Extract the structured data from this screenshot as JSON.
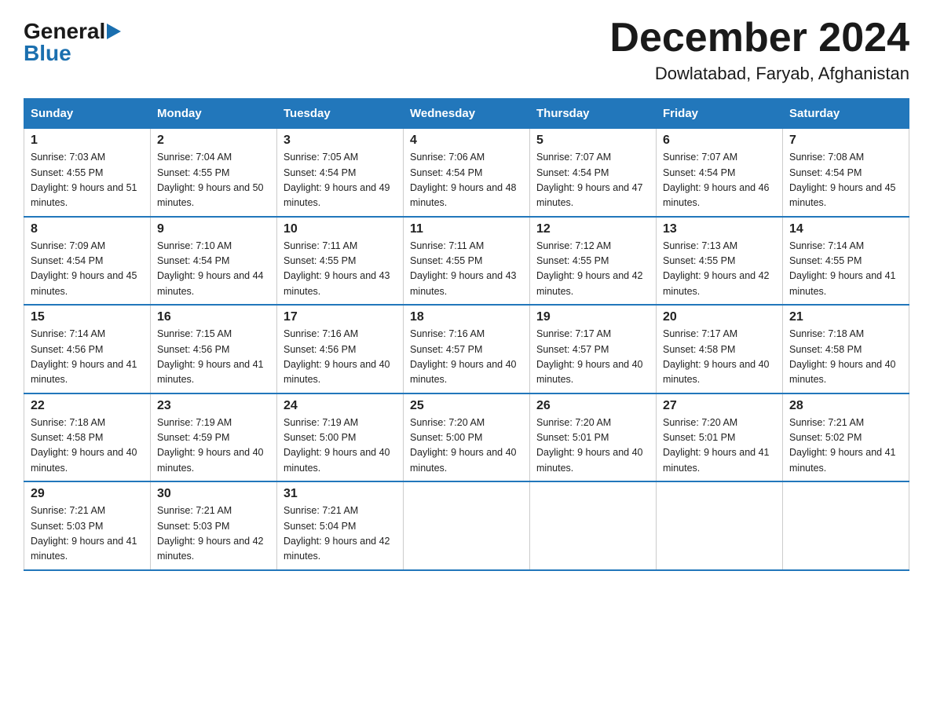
{
  "header": {
    "logo_general": "General",
    "logo_blue": "Blue",
    "month_title": "December 2024",
    "location": "Dowlatabad, Faryab, Afghanistan"
  },
  "weekdays": [
    "Sunday",
    "Monday",
    "Tuesday",
    "Wednesday",
    "Thursday",
    "Friday",
    "Saturday"
  ],
  "weeks": [
    [
      {
        "day": "1",
        "sunrise": "Sunrise: 7:03 AM",
        "sunset": "Sunset: 4:55 PM",
        "daylight": "Daylight: 9 hours and 51 minutes."
      },
      {
        "day": "2",
        "sunrise": "Sunrise: 7:04 AM",
        "sunset": "Sunset: 4:55 PM",
        "daylight": "Daylight: 9 hours and 50 minutes."
      },
      {
        "day": "3",
        "sunrise": "Sunrise: 7:05 AM",
        "sunset": "Sunset: 4:54 PM",
        "daylight": "Daylight: 9 hours and 49 minutes."
      },
      {
        "day": "4",
        "sunrise": "Sunrise: 7:06 AM",
        "sunset": "Sunset: 4:54 PM",
        "daylight": "Daylight: 9 hours and 48 minutes."
      },
      {
        "day": "5",
        "sunrise": "Sunrise: 7:07 AM",
        "sunset": "Sunset: 4:54 PM",
        "daylight": "Daylight: 9 hours and 47 minutes."
      },
      {
        "day": "6",
        "sunrise": "Sunrise: 7:07 AM",
        "sunset": "Sunset: 4:54 PM",
        "daylight": "Daylight: 9 hours and 46 minutes."
      },
      {
        "day": "7",
        "sunrise": "Sunrise: 7:08 AM",
        "sunset": "Sunset: 4:54 PM",
        "daylight": "Daylight: 9 hours and 45 minutes."
      }
    ],
    [
      {
        "day": "8",
        "sunrise": "Sunrise: 7:09 AM",
        "sunset": "Sunset: 4:54 PM",
        "daylight": "Daylight: 9 hours and 45 minutes."
      },
      {
        "day": "9",
        "sunrise": "Sunrise: 7:10 AM",
        "sunset": "Sunset: 4:54 PM",
        "daylight": "Daylight: 9 hours and 44 minutes."
      },
      {
        "day": "10",
        "sunrise": "Sunrise: 7:11 AM",
        "sunset": "Sunset: 4:55 PM",
        "daylight": "Daylight: 9 hours and 43 minutes."
      },
      {
        "day": "11",
        "sunrise": "Sunrise: 7:11 AM",
        "sunset": "Sunset: 4:55 PM",
        "daylight": "Daylight: 9 hours and 43 minutes."
      },
      {
        "day": "12",
        "sunrise": "Sunrise: 7:12 AM",
        "sunset": "Sunset: 4:55 PM",
        "daylight": "Daylight: 9 hours and 42 minutes."
      },
      {
        "day": "13",
        "sunrise": "Sunrise: 7:13 AM",
        "sunset": "Sunset: 4:55 PM",
        "daylight": "Daylight: 9 hours and 42 minutes."
      },
      {
        "day": "14",
        "sunrise": "Sunrise: 7:14 AM",
        "sunset": "Sunset: 4:55 PM",
        "daylight": "Daylight: 9 hours and 41 minutes."
      }
    ],
    [
      {
        "day": "15",
        "sunrise": "Sunrise: 7:14 AM",
        "sunset": "Sunset: 4:56 PM",
        "daylight": "Daylight: 9 hours and 41 minutes."
      },
      {
        "day": "16",
        "sunrise": "Sunrise: 7:15 AM",
        "sunset": "Sunset: 4:56 PM",
        "daylight": "Daylight: 9 hours and 41 minutes."
      },
      {
        "day": "17",
        "sunrise": "Sunrise: 7:16 AM",
        "sunset": "Sunset: 4:56 PM",
        "daylight": "Daylight: 9 hours and 40 minutes."
      },
      {
        "day": "18",
        "sunrise": "Sunrise: 7:16 AM",
        "sunset": "Sunset: 4:57 PM",
        "daylight": "Daylight: 9 hours and 40 minutes."
      },
      {
        "day": "19",
        "sunrise": "Sunrise: 7:17 AM",
        "sunset": "Sunset: 4:57 PM",
        "daylight": "Daylight: 9 hours and 40 minutes."
      },
      {
        "day": "20",
        "sunrise": "Sunrise: 7:17 AM",
        "sunset": "Sunset: 4:58 PM",
        "daylight": "Daylight: 9 hours and 40 minutes."
      },
      {
        "day": "21",
        "sunrise": "Sunrise: 7:18 AM",
        "sunset": "Sunset: 4:58 PM",
        "daylight": "Daylight: 9 hours and 40 minutes."
      }
    ],
    [
      {
        "day": "22",
        "sunrise": "Sunrise: 7:18 AM",
        "sunset": "Sunset: 4:58 PM",
        "daylight": "Daylight: 9 hours and 40 minutes."
      },
      {
        "day": "23",
        "sunrise": "Sunrise: 7:19 AM",
        "sunset": "Sunset: 4:59 PM",
        "daylight": "Daylight: 9 hours and 40 minutes."
      },
      {
        "day": "24",
        "sunrise": "Sunrise: 7:19 AM",
        "sunset": "Sunset: 5:00 PM",
        "daylight": "Daylight: 9 hours and 40 minutes."
      },
      {
        "day": "25",
        "sunrise": "Sunrise: 7:20 AM",
        "sunset": "Sunset: 5:00 PM",
        "daylight": "Daylight: 9 hours and 40 minutes."
      },
      {
        "day": "26",
        "sunrise": "Sunrise: 7:20 AM",
        "sunset": "Sunset: 5:01 PM",
        "daylight": "Daylight: 9 hours and 40 minutes."
      },
      {
        "day": "27",
        "sunrise": "Sunrise: 7:20 AM",
        "sunset": "Sunset: 5:01 PM",
        "daylight": "Daylight: 9 hours and 41 minutes."
      },
      {
        "day": "28",
        "sunrise": "Sunrise: 7:21 AM",
        "sunset": "Sunset: 5:02 PM",
        "daylight": "Daylight: 9 hours and 41 minutes."
      }
    ],
    [
      {
        "day": "29",
        "sunrise": "Sunrise: 7:21 AM",
        "sunset": "Sunset: 5:03 PM",
        "daylight": "Daylight: 9 hours and 41 minutes."
      },
      {
        "day": "30",
        "sunrise": "Sunrise: 7:21 AM",
        "sunset": "Sunset: 5:03 PM",
        "daylight": "Daylight: 9 hours and 42 minutes."
      },
      {
        "day": "31",
        "sunrise": "Sunrise: 7:21 AM",
        "sunset": "Sunset: 5:04 PM",
        "daylight": "Daylight: 9 hours and 42 minutes."
      },
      null,
      null,
      null,
      null
    ]
  ]
}
